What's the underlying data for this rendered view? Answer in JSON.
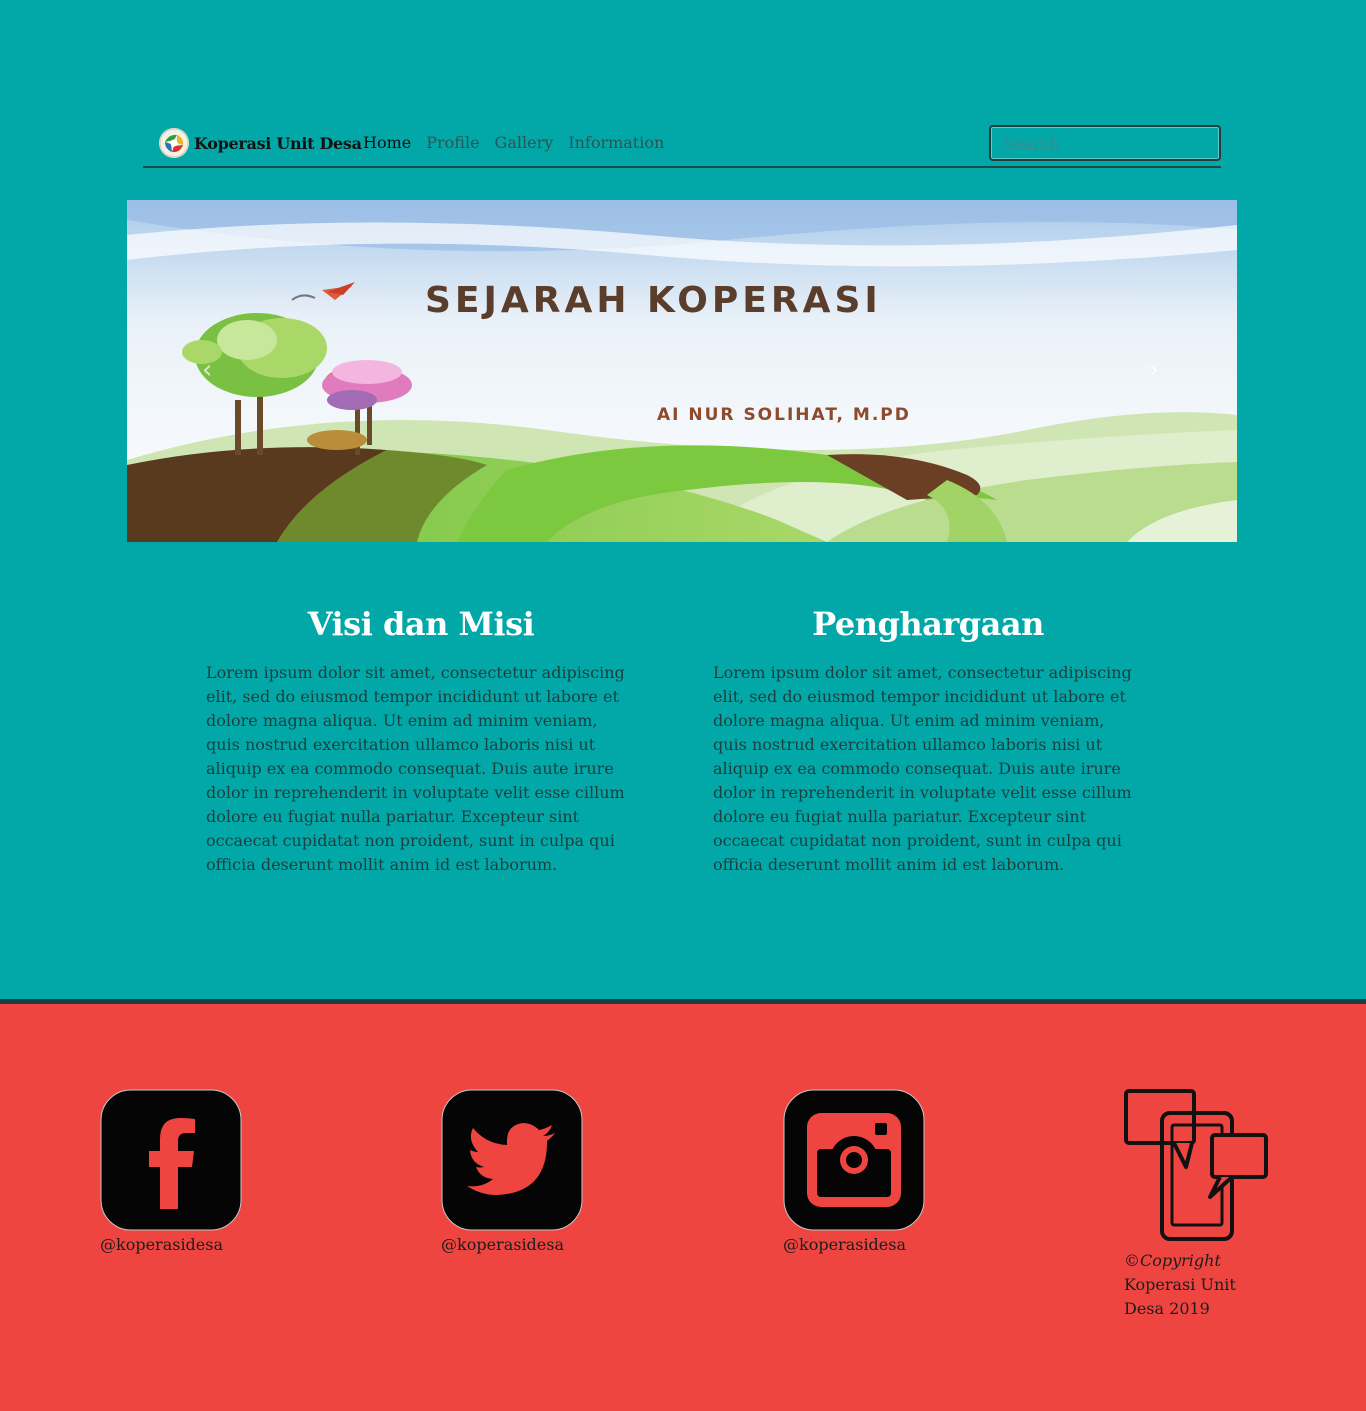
{
  "header": {
    "brand": "Koperasi Unit Desa",
    "nav": [
      "Home",
      "Profile",
      "Gallery",
      "Information"
    ],
    "search_placeholder": "Search"
  },
  "hero": {
    "title": "SEJARAH KOPERASI",
    "subtitle": "AI NUR SOLIHAT, M.PD",
    "prev_icon": "chevron-left-icon",
    "next_icon": "chevron-right-icon",
    "prev_glyph": "‹",
    "next_glyph": "›"
  },
  "sections": [
    {
      "title": "Visi dan Misi",
      "body": "Lorem ipsum dolor sit amet, consectetur adipiscing elit, sed do eiusmod tempor incididunt ut labore et dolore magna aliqua. Ut enim ad minim veniam, quis nostrud exercitation ullamco laboris nisi ut aliquip ex ea commodo consequat. Duis aute irure dolor in reprehenderit in voluptate velit esse cillum dolore eu fugiat nulla pariatur. Excepteur sint occaecat cupidatat non proident, sunt in culpa qui officia deserunt mollit anim id est laborum."
    },
    {
      "title": "Penghargaan",
      "body": "Lorem ipsum dolor sit amet, consectetur adipiscing elit, sed do eiusmod tempor incididunt ut labore et dolore magna aliqua. Ut enim ad minim veniam, quis nostrud exercitation ullamco laboris nisi ut aliquip ex ea commodo consequat. Duis aute irure dolor in reprehenderit in voluptate velit esse cillum dolore eu fugiat nulla pariatur. Excepteur sint occaecat cupidatat non proident, sunt in culpa qui officia deserunt mollit anim id est laborum."
    }
  ],
  "footer": {
    "facebook": "@koperasidesa",
    "twitter": "@koperasidesa",
    "instagram": "@koperasidesa",
    "copyright_symbol": "©",
    "copyright_word": "Copyright",
    "copyright_line": "Koperasi Unit Desa 2019"
  },
  "colors": {
    "page_bg": "#02a8a8",
    "footer_bg": "#ef4541",
    "heading": "#ffffff"
  }
}
